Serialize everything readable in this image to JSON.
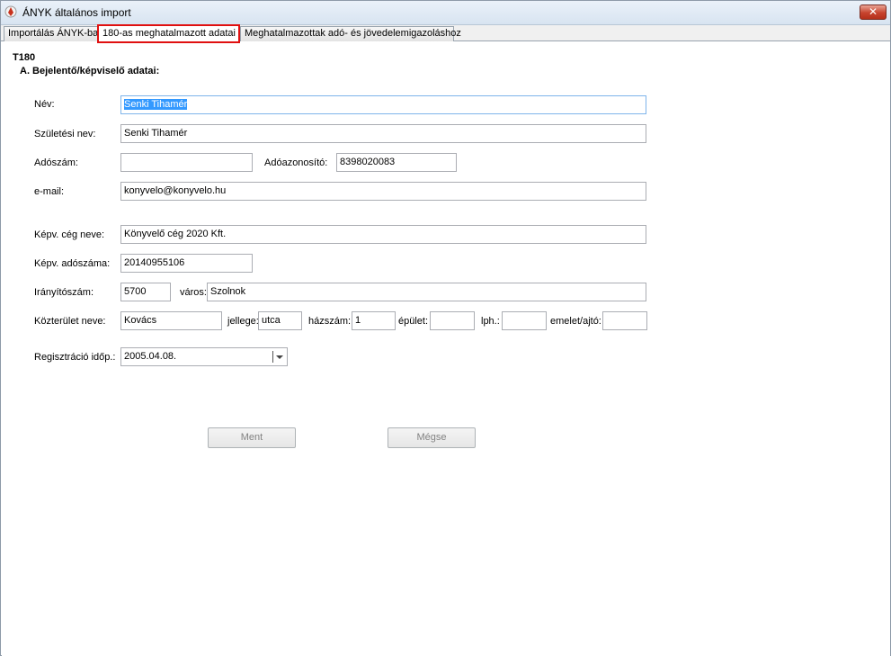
{
  "window": {
    "title": "ÁNYK általános import",
    "close_label": "✕"
  },
  "tabs": [
    {
      "label": "Importálás ÁNYK-ba",
      "active": false
    },
    {
      "label": "180-as meghatalmazott adatai",
      "active": true
    },
    {
      "label": "Meghatalmazottak adó- és jövedelemigazoláshoz",
      "active": false
    }
  ],
  "form": {
    "section_code": "T180",
    "section_title": "A. Bejelentő/képviselő adatai:",
    "nev": {
      "label": "Név:",
      "value": "Senki Tihamér"
    },
    "szuletesi_nev": {
      "label": "Születési nev:",
      "value": "Senki Tihamér"
    },
    "adoszam": {
      "label": "Adószám:",
      "value": ""
    },
    "adoazonosito": {
      "label": "Adóazonosító:",
      "value": "8398020083"
    },
    "email": {
      "label": "e-mail:",
      "value": "konyvelo@konyvelo.hu"
    },
    "kepv_ceg_neve": {
      "label": "Képv. cég neve:",
      "value": "Könyvelő cég 2020 Kft."
    },
    "kepv_adoszama": {
      "label": "Képv. adószáma:",
      "value": "20140955106"
    },
    "iranyitoszam": {
      "label": "Irányítószám:",
      "value": "5700"
    },
    "varos": {
      "label": "város:",
      "value": "Szolnok"
    },
    "kozterulet_neve": {
      "label": "Közterület neve:",
      "value": "Kovács"
    },
    "jellege": {
      "label": "jellege:",
      "value": "utca"
    },
    "hazszam": {
      "label": "házszám:",
      "value": "1"
    },
    "epulet": {
      "label": "épület:",
      "value": ""
    },
    "lph": {
      "label": "lph.:",
      "value": ""
    },
    "emelet_ajto": {
      "label": "emelet/ajtó:",
      "value": ""
    },
    "regisztracio": {
      "label": "Regisztráció időp.:",
      "value": "2005.04.08."
    }
  },
  "buttons": {
    "save": "Ment",
    "cancel": "Mégse"
  }
}
